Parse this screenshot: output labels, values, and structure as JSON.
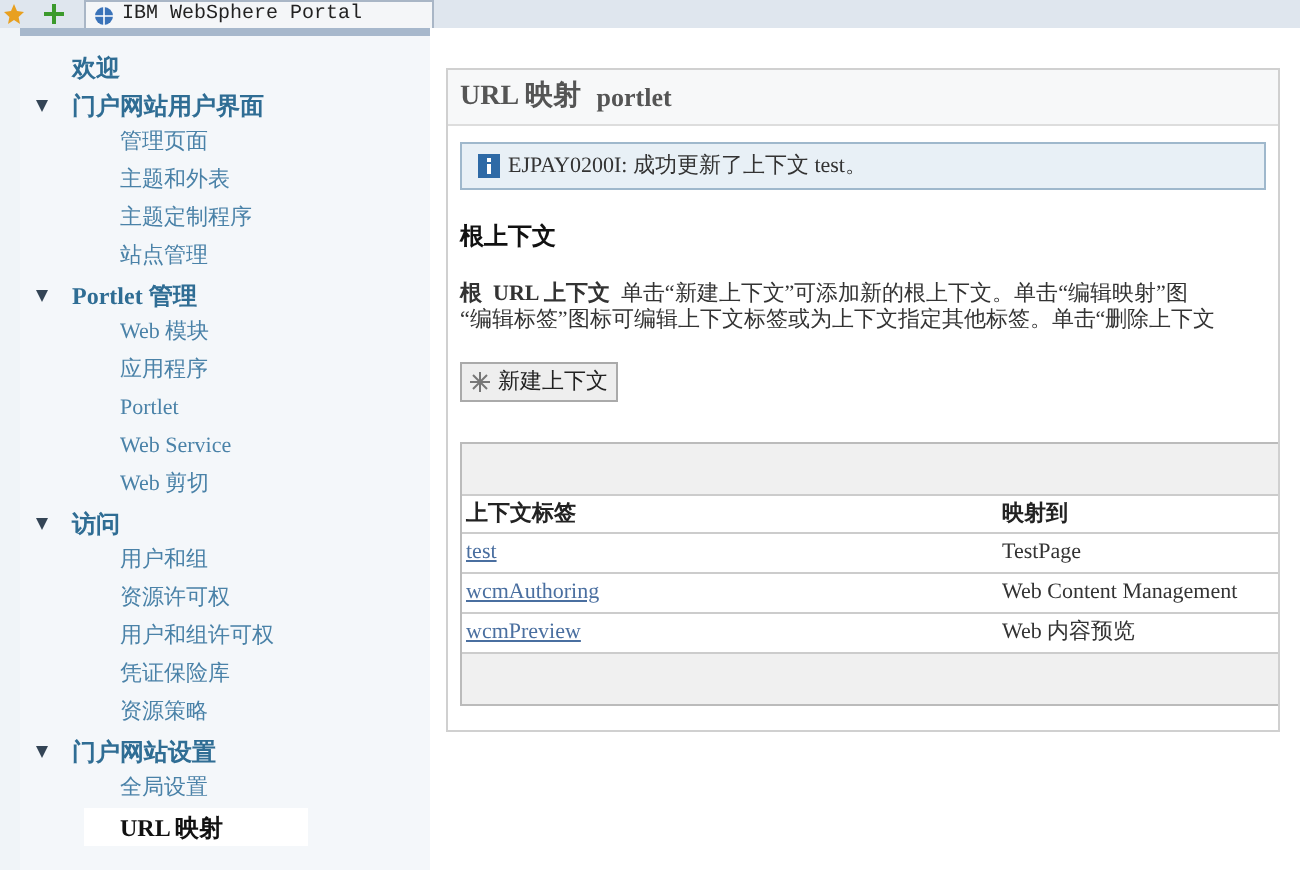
{
  "browser_tab": {
    "title": "IBM WebSphere Portal"
  },
  "sidebar": {
    "items": [
      {
        "label": "欢迎",
        "selected": false
      },
      {
        "label": "门户网站用户界面",
        "expanded": true,
        "children": [
          {
            "label": "管理页面",
            "selected": false
          },
          {
            "label": "主题和外表",
            "selected": false
          },
          {
            "label": "主题定制程序",
            "selected": false
          },
          {
            "label": "站点管理",
            "selected": false
          }
        ]
      },
      {
        "label": "Portlet 管理",
        "expanded": true,
        "children": [
          {
            "label": "Web 模块",
            "selected": false
          },
          {
            "label": "应用程序",
            "selected": false
          },
          {
            "label": "Portlet",
            "selected": false
          },
          {
            "label": "Web Service",
            "selected": false
          },
          {
            "label": "Web 剪切",
            "selected": false
          }
        ]
      },
      {
        "label": "访问",
        "expanded": true,
        "children": [
          {
            "label": "用户和组",
            "selected": false
          },
          {
            "label": "资源许可权",
            "selected": false
          },
          {
            "label": "用户和组许可权",
            "selected": false
          },
          {
            "label": "凭证保险库",
            "selected": false
          },
          {
            "label": "资源策略",
            "selected": false
          }
        ]
      },
      {
        "label": "门户网站设置",
        "expanded": true,
        "children": [
          {
            "label": "全局设置",
            "selected": false
          },
          {
            "label": "URL 映射",
            "selected": true
          }
        ]
      }
    ]
  },
  "portlet": {
    "title": "URL 映射",
    "subtitle": "portlet",
    "message": "EJPAY0200I: 成功更新了上下文  test。",
    "section_title": "根上下文",
    "description": "**根  URL 上下文**  单击“新建上下文”可添加新的根上下文。单击“编辑映射”图\n“编辑标签”图标可编辑上下文标签或为上下文指定其他标签。单击“删除上下文",
    "new_button": "新建上下文",
    "table": {
      "columns": [
        "上下文标签",
        "映射到"
      ],
      "rows": [
        [
          "test",
          "TestPage"
        ],
        [
          "wcmAuthoring",
          "Web Content Management"
        ],
        [
          "wcmPreview",
          "Web 内容预览"
        ]
      ]
    }
  }
}
